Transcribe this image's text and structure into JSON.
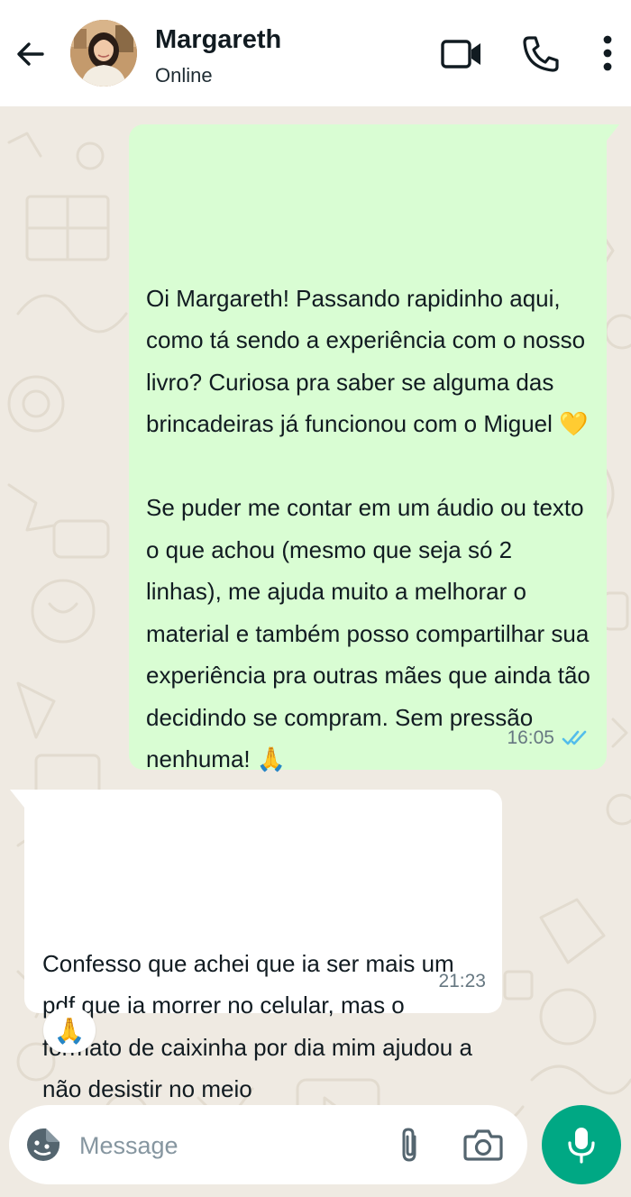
{
  "header": {
    "contact_name": "Margareth",
    "status": "Online",
    "icons": [
      "back-arrow-icon",
      "video-camera-icon",
      "phone-icon",
      "more-vertical-icon"
    ]
  },
  "messages": [
    {
      "direction": "outgoing",
      "text": "Oi Margareth! Passando rapidinho aqui, como tá sendo a experiência com o nosso livro? Curiosa pra saber se alguma das brincadeiras já funcionou com o Miguel 💛\n\nSe puder me contar em um áudio ou texto o que achou (mesmo que seja só 2 linhas), me ajuda muito a melhorar o material e também posso compartilhar sua experiência pra outras mães que ainda tão decidindo se compram. Sem pressão nenhuma! 🙏",
      "time": "16:05",
      "read_receipt": "double-check-blue"
    },
    {
      "direction": "incoming",
      "text": "Confesso que achei que ia ser mais um pdf que ia morrer no celular, mas o formato de caixinha por dia mim ajudou a não desistir no meio",
      "time": "21:23",
      "reaction": "🙏"
    }
  ],
  "composer": {
    "placeholder": "Message",
    "value": ""
  },
  "colors": {
    "header_bg": "#ffffff",
    "chat_bg": "#efeae2",
    "outgoing_bubble": "#d9fdd3",
    "incoming_bubble": "#ffffff",
    "accent": "#00a884",
    "read_receipt": "#53bdeb",
    "timestamp": "#667781"
  }
}
